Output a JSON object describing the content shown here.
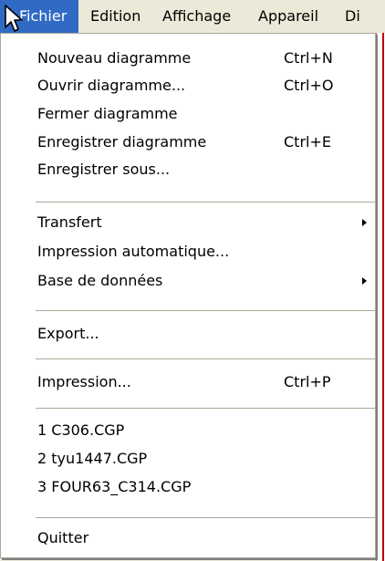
{
  "menubar": {
    "items": [
      {
        "label": "Fichier",
        "name": "menubar-fichier"
      },
      {
        "label": "Edition",
        "name": "menubar-edition"
      },
      {
        "label": "Affichage",
        "name": "menubar-affichage"
      },
      {
        "label": "Appareil",
        "name": "menubar-appareil"
      },
      {
        "label": "Di",
        "name": "menubar-di"
      }
    ]
  },
  "menu": {
    "items": [
      {
        "label": "Nouveau diagramme",
        "shortcut": "Ctrl+N"
      },
      {
        "label": "Ouvrir diagramme...",
        "shortcut": "Ctrl+O"
      },
      {
        "label": "Fermer diagramme",
        "shortcut": ""
      },
      {
        "label": "Enregistrer diagramme",
        "shortcut": "Ctrl+E"
      },
      {
        "label": "Enregistrer sous...",
        "shortcut": ""
      },
      {
        "label": "Transfert",
        "shortcut": ""
      },
      {
        "label": "Impression automatique...",
        "shortcut": ""
      },
      {
        "label": "Base de données",
        "shortcut": ""
      },
      {
        "label": "Export...",
        "shortcut": ""
      },
      {
        "label": "Impression...",
        "shortcut": "Ctrl+P"
      },
      {
        "label": "1 C306.CGP",
        "shortcut": ""
      },
      {
        "label": "2 tyu1447.CGP",
        "shortcut": ""
      },
      {
        "label": "3 FOUR63_C314.CGP",
        "shortcut": ""
      },
      {
        "label": "Quitter",
        "shortcut": ""
      }
    ]
  },
  "colors": {
    "highlight": "#316ac5",
    "menu_bg": "#ffffff",
    "bar_bg": "#ece9d8",
    "separator": "#aca899"
  },
  "icons": {
    "cursor": "mouse-pointer-icon",
    "submenu": "submenu-arrow-icon"
  }
}
